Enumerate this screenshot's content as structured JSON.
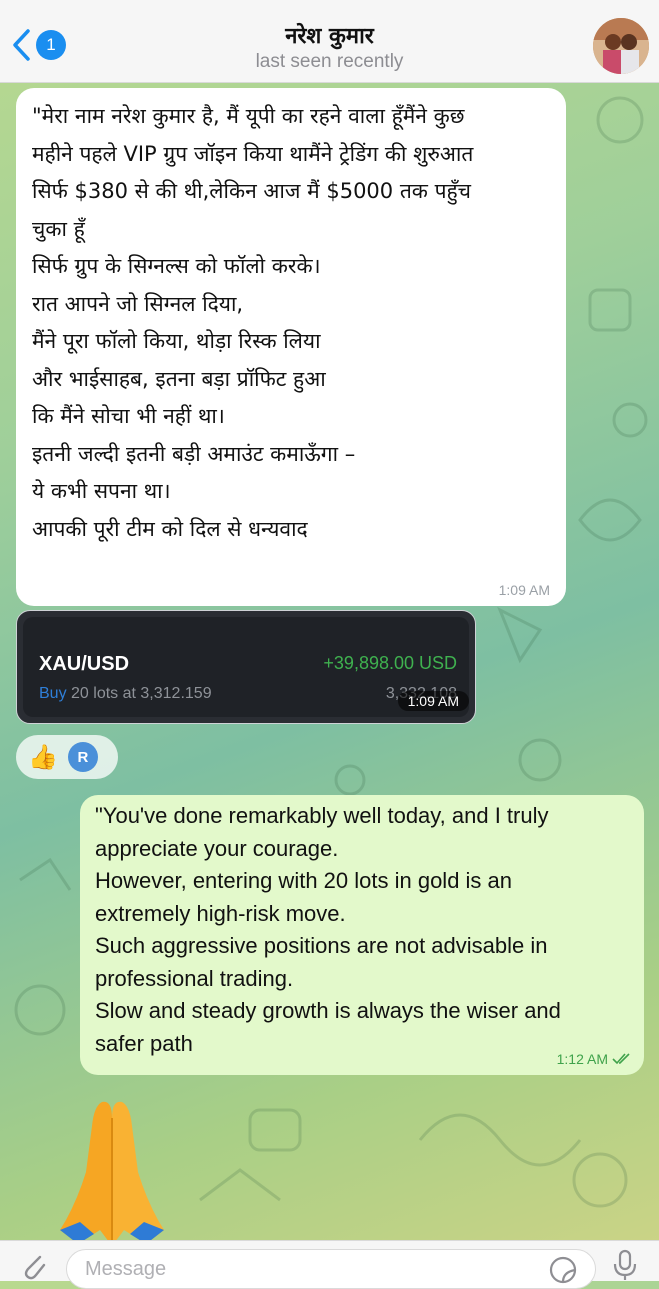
{
  "header": {
    "back_badge": "1",
    "title": "नरेश कुमार",
    "status": "last seen recently"
  },
  "incoming_message": {
    "lines": [
      "\"मेरा नाम नरेश कुमार है, मैं यूपी का रहने वाला हूँमैंने कुछ",
      "महीने पहले VIP ग्रुप जॉइन किया थामैंने ट्रेडिंग की शुरुआत",
      "सिर्फ $380 से की थी,लेकिन आज मैं $5000 तक पहुँच",
      "चुका हूँ",
      "सिर्फ ग्रुप के सिग्नल्स को फॉलो करके।",
      "रात आपने जो सिग्नल दिया,",
      "मैंने पूरा फॉलो किया, थोड़ा रिस्क लिया",
      "और भाईसाहब, इतना बड़ा प्रॉफिट हुआ",
      "कि मैंने सोचा भी नहीं था।",
      "इतनी जल्दी इतनी बड़ी अमाउंट कमाऊँगा –",
      "ये कभी सपना था।",
      "आपकी पूरी टीम को दिल से धन्यवाद"
    ],
    "time": "1:09 AM"
  },
  "trade_screenshot": {
    "symbol": "XAU/USD",
    "profit": "+39,898.00 USD",
    "side": "Buy",
    "detail": "20 lots at 3,312.159",
    "current_price": "3,332.108",
    "time": "1:09 AM"
  },
  "reaction": {
    "emoji": "👍",
    "reactor_initial": "R"
  },
  "outgoing_message": {
    "lines": [
      "\"You've done remarkably well today, and I truly",
      "appreciate your courage.",
      "However, entering with 20 lots in gold is an",
      "extremely high-risk move.",
      "Such aggressive positions are not advisable in",
      "professional trading.",
      "Slow and steady growth is always the wiser and",
      "safer path"
    ],
    "time": "1:12 AM"
  },
  "composer": {
    "placeholder": "Message"
  },
  "colors": {
    "accent": "#1a8ef0",
    "outgoing_bubble": "#e3f9cb",
    "profit_green": "#3fb14f",
    "read_ticks": "#3fa24b"
  },
  "icons": [
    "back-chevron-icon",
    "attach-icon",
    "sticker-icon",
    "microphone-icon",
    "double-check-icon",
    "folded-hands-emoji"
  ]
}
